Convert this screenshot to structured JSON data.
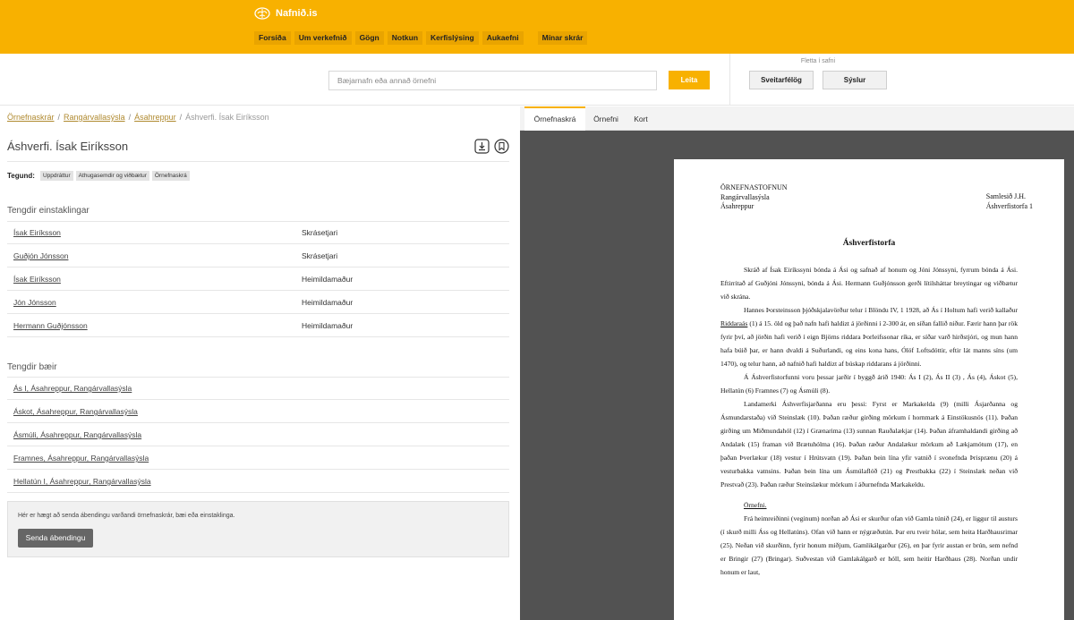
{
  "header": {
    "logo_text": "Nafnið.is",
    "nav": [
      "Forsíða",
      "Um verkefnið",
      "Gögn",
      "Notkun",
      "Kerfislýsing",
      "Aukaefni"
    ],
    "nav_extra": "Mínar skrár"
  },
  "search": {
    "placeholder": "Bæjarnafn eða annað örnefni",
    "button": "Leita",
    "browse_label": "Fletta í safni",
    "browse_buttons": [
      "Sveitarfélög",
      "Sýslur"
    ]
  },
  "breadcrumb": [
    "Örnefnaskrár",
    "Rangárvallasýsla",
    "Ásahreppur",
    "Áshverfi. Ísak Eiríksson"
  ],
  "title": "Áshverfi. Ísak Eiríksson",
  "tegund": {
    "label": "Tegund:",
    "tags": [
      "Uppdráttur",
      "Athugasemdir og viðbætur",
      "Örnefnaskrá"
    ]
  },
  "persons": {
    "title": "Tengdir einstaklingar",
    "rows": [
      {
        "name": "Ísak Eiríksson",
        "role": "Skrásetjari"
      },
      {
        "name": "Guðjón Jónsson",
        "role": "Skrásetjari"
      },
      {
        "name": "Ísak Eiríksson",
        "role": "Heimildamaður"
      },
      {
        "name": "Jón Jónsson",
        "role": "Heimildamaður"
      },
      {
        "name": "Hermann Guðjónsson",
        "role": "Heimildamaður"
      }
    ]
  },
  "farms": {
    "title": "Tengdir bæir",
    "rows": [
      "Ás I, Ásahreppur, Rangárvallasýsla",
      "Áskot, Ásahreppur, Rangárvallasýsla",
      "Ásmúli, Ásahreppur, Rangárvallasýsla",
      "Framnes, Ásahreppur, Rangárvallasýsla",
      "Hellatún I, Ásahreppur, Rangárvallasýsla"
    ]
  },
  "feedback": {
    "text": "Hér er hægt að senda ábendingu varðandi örnefnaskrár, bæi eða einstaklinga.",
    "button": "Senda ábendingu"
  },
  "viewer": {
    "tabs": [
      "Örnefnaskrá",
      "Örnefni",
      "Kort"
    ],
    "active_tab": "Örnefnaskrá"
  },
  "document": {
    "head_left": [
      "ÖRNEFNASTOFNUN",
      "Rangárvallasýsla",
      "Ásahreppur"
    ],
    "head_right": [
      "Samlesið J.H.",
      "Áshverfistorfa 1"
    ],
    "title": "Áshverfistorfa",
    "p1": "Skráð af Ísak Eiríkssyni bónda á Ási og safnað af honum og Jóni Jónssyni, fyrrum bónda á Ási.  Eftirritað af Guðjóni Jónssyni, bónda á Ási.  Hermann Guðjónsson gerði lítilsháttar breytingar og viðbætur við skrána.",
    "p2a": "Hannes Þorsteinsson þjóðskjalavörður telur í Blöndu IV, 1 1928, að Ás í Holtum hafi verið kallaður ",
    "p2b": "Riddaraás",
    "p2c": " (1) á 15. öld og það nafn hafi haldizt á jörðinni í 2-300 ár, en síðan fallið niður.  Færir hann þar rök fyrir því, að jörðin hafi verið í eign Björns riddara Þorleifssonar ríka, er síðar varð hirðstjóri, og mun hann hafa búið þar, er hann dvaldi á Suðurlandi, og eins kona hans, Ólöf Loftsdóttir, eftir lát manns síns (um 1470), og telur hann, að nafnið hafi haldizt af búskap riddarans á jörðinni.",
    "p3": "Á Áshverfistorfunni voru þessar jarðir í byggð árið 1940: Ás I (2), Ás II (3) , Ás (4), Áskot (5), Hellatún (6) Framnes (7) og Ásmúli (8).",
    "p4": "Landamerki Áshverfisjarðanna eru þessi: Fyrst er Markakelda (9) (milli Ásjarðanna og Ásmundarstaða) við Steinslæk (10).  Þaðan ræður girðing mörkum í hornmark á Einstökusnös (11).  Þaðan girðing um  Miðmundahól (12) í Grænarima (13) sunnan Rauðalækjar (14). Þaðan áframhaldandi girðing að Andalæk (15) framan við Brætuhólma (16).  Þaðan ræður Andalækur mörkum að Lækjamótum (17), en þaðan Þverlækur (18) vestur í Hrútsvatn (19).  Þaðan bein lína yfir vatnið í svonefnda Þrisprænu (20) á vesturbakka vatnsins.  Þaðan bein lína um Ásmúlaflóð (21) og Prestbakka (22) í Steinslæk neðan við Prestvað (23).  Þaðan ræður Steinslækur mörkum í áðurnefnda Markakeldu.",
    "subhead": "Örnefni.",
    "p5": "Frá heimreiðinni (veginum) norðan að Ási er skurður ofan við Gamla túnið (24), er liggur til austurs (í skurð milli Áss og Hellatúns).  Ofan við hann er nýgræðutún.  Þar eru tveir hólar, sem heita Harðhausrimar (25).  Neðan við skurðinn, fyrir honum miðjum, Gamlikálgarður (26), en þar fyrir austan er brún, sem nefnd er Bringir (27) (Bringar). Suðvestan við Gamlakálgarð er hóll, sem heitir Harðhaus (28).  Norðan undir honum er laut,"
  }
}
